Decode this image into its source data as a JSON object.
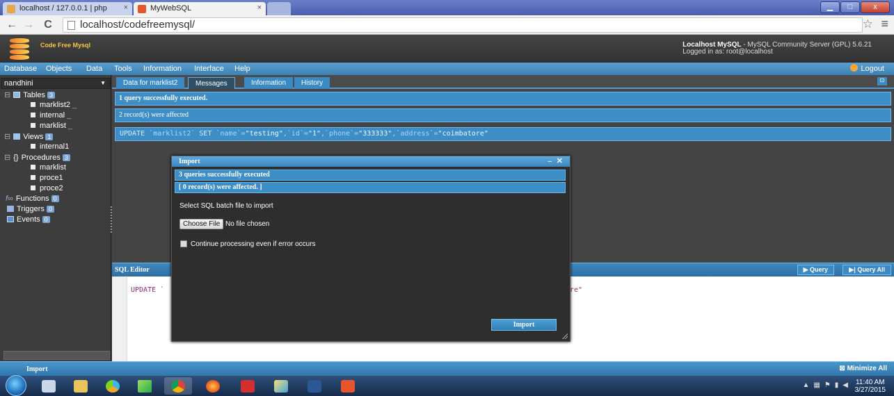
{
  "browser": {
    "tabs": [
      {
        "label": "localhost / 127.0.0.1 | php",
        "close": "×"
      },
      {
        "label": "MyWebSQL",
        "close": "×"
      }
    ],
    "url": "localhost/codefreemysql/",
    "back": "←",
    "forward": "→",
    "reload": "C",
    "star": "☆",
    "menu": "≡",
    "window_buttons": {
      "minimize": "▁",
      "maximize": "□",
      "close": "x"
    }
  },
  "app": {
    "name": "Code Free Mysql",
    "server_title": "Localhost MySQL",
    "server_desc": " - MySQL Community Server (GPL) 5.6.21",
    "logged_in": "Logged in as: root@localhost"
  },
  "menubar": {
    "items": [
      "Database",
      "Objects",
      "Data",
      "Tools",
      "Information",
      "Interface",
      "Help"
    ],
    "logout": "Logout"
  },
  "sidebar": {
    "database": "nandhini",
    "tables": {
      "label": "Tables",
      "count": "3",
      "items": [
        "marklist2",
        "internal",
        "marklist"
      ]
    },
    "views": {
      "label": "Views",
      "count": "1",
      "items": [
        "internal1"
      ]
    },
    "procedures": {
      "label": "Procedures",
      "count": "3",
      "items": [
        "marklist",
        "proce1",
        "proce2"
      ]
    },
    "functions": {
      "label": "Functions",
      "count": "0"
    },
    "triggers": {
      "label": "Triggers",
      "count": "0"
    },
    "events": {
      "label": "Events",
      "count": "0"
    }
  },
  "main": {
    "tabs": [
      "Data for marklist2",
      "Messages",
      "Information",
      "History"
    ],
    "active_tab": "Messages",
    "messages": [
      "1 query successfully executed.",
      "2 record(s) were affected"
    ],
    "sql": {
      "kw1": "UPDATE",
      "p1": " `marklist2` ",
      "kw2": "SET",
      "p2": " `name`=",
      "s1": "\"testing\"",
      "p3": ",`id`=",
      "s2": "\"1\"",
      "p4": ",`phone`=",
      "s3": "\"333333\"",
      "p5": ",`address`=",
      "s4": "\"coimbatore\""
    },
    "editor_title": "SQL Editor",
    "query_btn": "Query",
    "query_all_btn": "Query All",
    "editor_code_left": "UPDATE `",
    "editor_code_right": "re\""
  },
  "dialog": {
    "title": "Import",
    "minimize": "–",
    "close": "✕",
    "msg1": "3 queries successfully executed",
    "msg2": "[ 0 record(s) were affected. ]",
    "prompt": "Select SQL batch file to import",
    "choose_file": "Choose File",
    "no_file": "No file chosen",
    "checkbox_label": "Continue processing even if error occurs",
    "checkbox_checked": false,
    "import_button": "Import"
  },
  "statusbar": {
    "import": "Import",
    "minimize_all": "Minimize All"
  },
  "taskbar": {
    "time": "11:40 AM",
    "date": "3/27/2015"
  },
  "colors": {
    "accent": "#3d8ec6",
    "header": "#333333",
    "logo": "#f6c646"
  }
}
